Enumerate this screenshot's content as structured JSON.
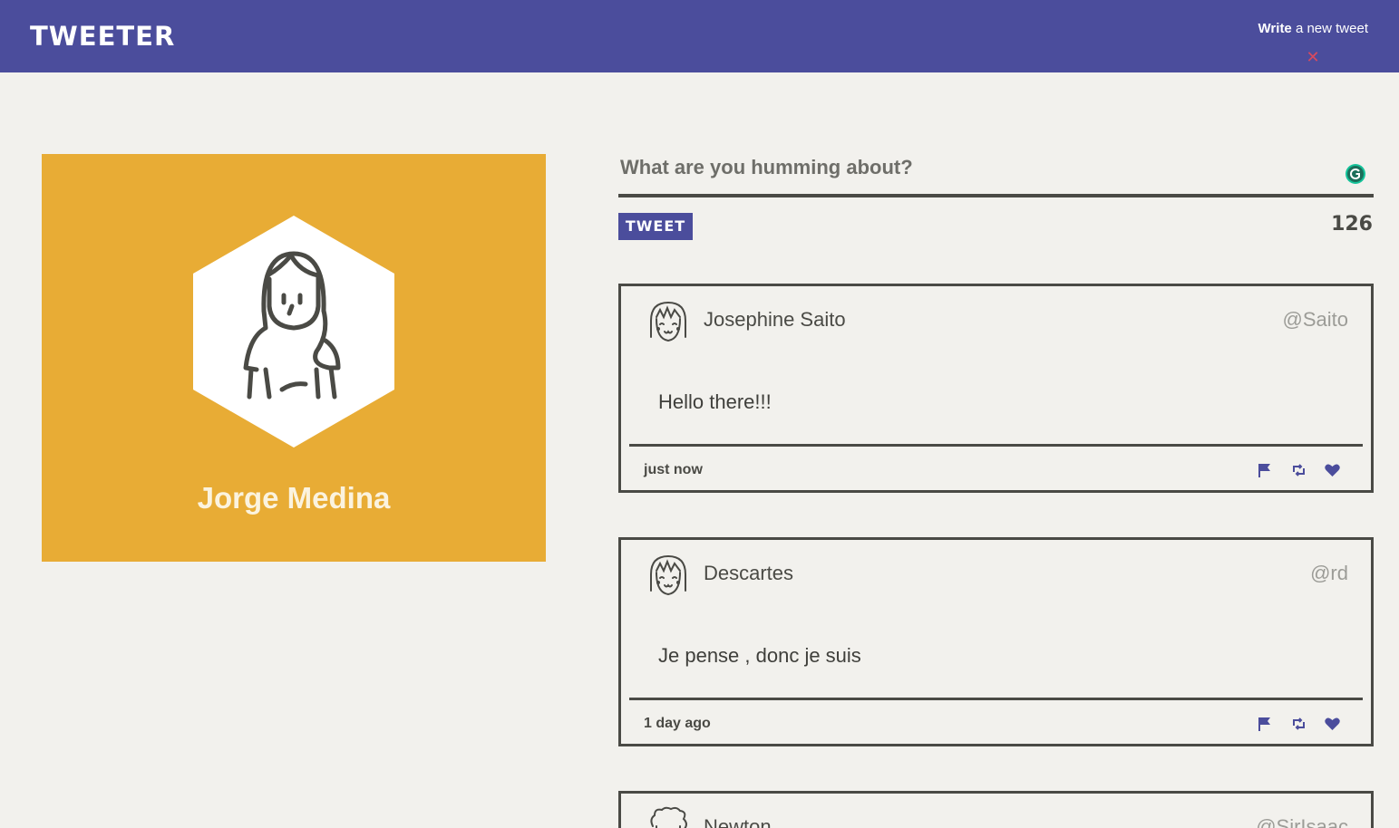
{
  "header": {
    "brand": "TWEETER",
    "compose_toggle_bold": "Write",
    "compose_toggle_rest": " a new tweet",
    "close_glyph": "✕"
  },
  "profile": {
    "name": "Jorge Medina",
    "bg_color": "#e8ac35"
  },
  "compose": {
    "placeholder": "What are you humming about?",
    "button_label": "TWEET",
    "char_counter": "126"
  },
  "tweets": [
    {
      "name": "Josephine Saito",
      "handle": "@Saito",
      "text": "Hello there!!!",
      "time": "just now"
    },
    {
      "name": "Descartes",
      "handle": "@rd",
      "text": "Je pense , donc je suis",
      "time": "1 day ago"
    },
    {
      "name": "Newton",
      "handle": "@SirIsaac",
      "text": "",
      "time": ""
    }
  ],
  "icons": [
    "flag-icon",
    "retweet-icon",
    "heart-icon",
    "grammarly-icon",
    "close-icon"
  ],
  "colors": {
    "accent": "#4b4d9c",
    "text": "#4a4a45",
    "background": "#f2f1ed",
    "close": "#d84a5e"
  }
}
